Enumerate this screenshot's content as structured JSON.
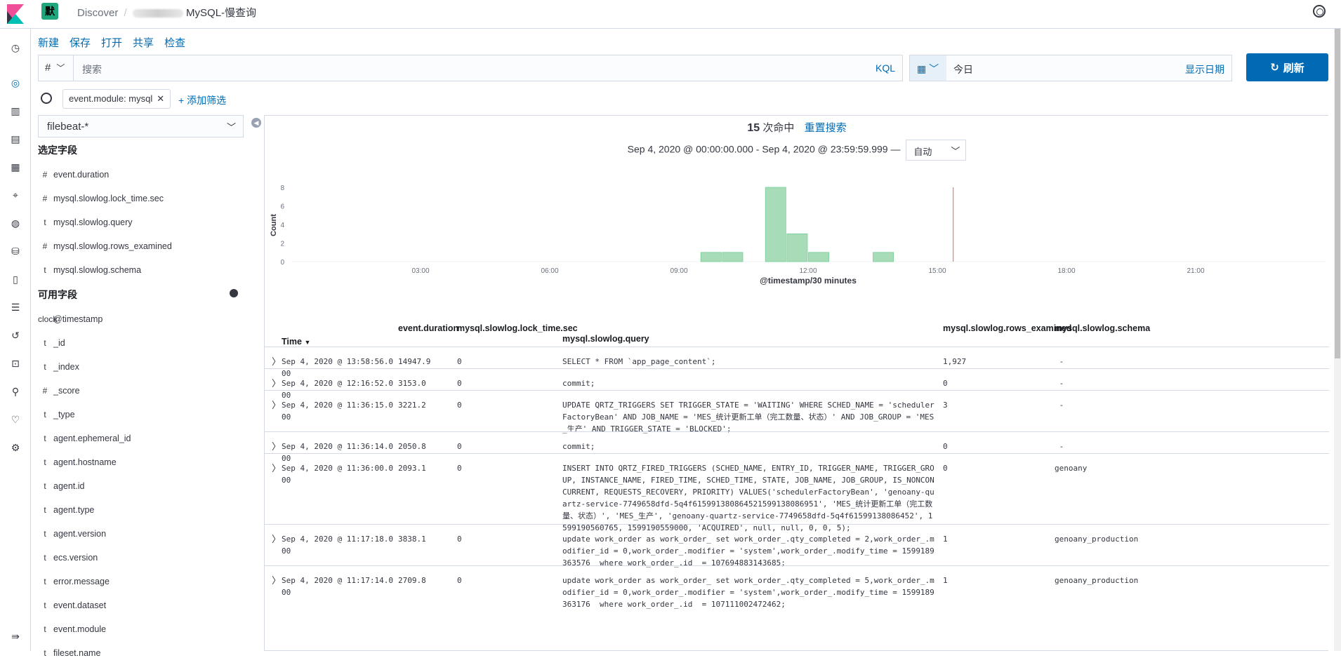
{
  "header": {
    "badge": "默",
    "crumb1": "Discover",
    "crumb_sep": "/",
    "crumb_current": "MySQL-慢查询"
  },
  "menu": [
    "新建",
    "保存",
    "打开",
    "共享",
    "检查"
  ],
  "query": {
    "type": "#",
    "placeholder": "搜索",
    "language": "KQL"
  },
  "date": {
    "value": "今日",
    "show_dates": "显示日期",
    "refresh": "刷新"
  },
  "filter": {
    "pill": "event.module: mysql",
    "add": "+ 添加筛选"
  },
  "sidebar": {
    "index_pattern": "filebeat-*",
    "selected_title": "选定字段",
    "selected": [
      {
        "type": "#",
        "name": "event.duration"
      },
      {
        "type": "#",
        "name": "mysql.slowlog.lock_time.sec"
      },
      {
        "type": "t",
        "name": "mysql.slowlog.query"
      },
      {
        "type": "#",
        "name": "mysql.slowlog.rows_examined"
      },
      {
        "type": "t",
        "name": "mysql.slowlog.schema"
      }
    ],
    "available_title": "可用字段",
    "available": [
      {
        "type": "clock",
        "name": "@timestamp"
      },
      {
        "type": "t",
        "name": "_id"
      },
      {
        "type": "t",
        "name": "_index"
      },
      {
        "type": "#",
        "name": "_score"
      },
      {
        "type": "t",
        "name": "_type"
      },
      {
        "type": "t",
        "name": "agent.ephemeral_id"
      },
      {
        "type": "t",
        "name": "agent.hostname"
      },
      {
        "type": "t",
        "name": "agent.id"
      },
      {
        "type": "t",
        "name": "agent.type"
      },
      {
        "type": "t",
        "name": "agent.version"
      },
      {
        "type": "t",
        "name": "ecs.version"
      },
      {
        "type": "t",
        "name": "error.message"
      },
      {
        "type": "t",
        "name": "event.dataset"
      },
      {
        "type": "t",
        "name": "event.module"
      },
      {
        "type": "t",
        "name": "fileset.name"
      }
    ]
  },
  "summary": {
    "count": "15",
    "hits_label": "次命中",
    "reset": "重置搜索",
    "range": "Sep 4, 2020 @ 00:00:00.000 - Sep 4, 2020 @ 23:59:59.999 —",
    "interval": "自动"
  },
  "chart_data": {
    "type": "bar",
    "ylabel": "Count",
    "xlabel": "@timestamp/30 minutes",
    "ylim": [
      0,
      8
    ],
    "yticks": [
      "0",
      "2",
      "4",
      "6",
      "8"
    ],
    "xticks": [
      "03:00",
      "06:00",
      "09:00",
      "12:00",
      "15:00",
      "18:00",
      "21:00"
    ],
    "bars": [
      {
        "start_hour": 9.5,
        "count": 1
      },
      {
        "start_hour": 10.0,
        "count": 1
      },
      {
        "start_hour": 11.0,
        "count": 8
      },
      {
        "start_hour": 11.5,
        "count": 3
      },
      {
        "start_hour": 12.0,
        "count": 1
      },
      {
        "start_hour": 13.5,
        "count": 1
      }
    ],
    "now_marker_hour": 15.37,
    "bar_color": "#a8dcb9",
    "marker_color": "#e7664c"
  },
  "table": {
    "headers": {
      "time": "Time",
      "duration": "event.duration",
      "lock": "mysql.slowlog.lock_time.sec",
      "query": "mysql.slowlog.query",
      "rows": "mysql.slowlog.rows_examined",
      "schema": "mysql.slowlog.schema"
    },
    "rows": [
      {
        "time": "Sep 4, 2020 @ 13:58:56.000",
        "duration": "14947.9",
        "lock": "0",
        "query": "SELECT * FROM `app_page_content`;",
        "rows": "1,927",
        "schema": " -"
      },
      {
        "time": "Sep 4, 2020 @ 12:16:52.000",
        "duration": "3153.0",
        "lock": "0",
        "query": "commit;",
        "rows": "0",
        "schema": " -"
      },
      {
        "time": "Sep 4, 2020 @ 11:36:15.000",
        "duration": "3221.2",
        "lock": "0",
        "query": "UPDATE QRTZ_TRIGGERS SET TRIGGER_STATE = 'WAITING' WHERE SCHED_NAME = 'schedulerFactoryBean' AND JOB_NAME = 'MES_统计更新工单（完工数量、状态）' AND JOB_GROUP = 'MES_生产' AND TRIGGER_STATE = 'BLOCKED';",
        "rows": "3",
        "schema": " -"
      },
      {
        "time": "Sep 4, 2020 @ 11:36:14.000",
        "duration": "2050.8",
        "lock": "0",
        "query": "commit;",
        "rows": "0",
        "schema": " -"
      },
      {
        "time": "Sep 4, 2020 @ 11:36:00.000",
        "duration": "2093.1",
        "lock": "0",
        "query": "INSERT INTO QRTZ_FIRED_TRIGGERS (SCHED_NAME, ENTRY_ID, TRIGGER_NAME, TRIGGER_GROUP, INSTANCE_NAME, FIRED_TIME, SCHED_TIME, STATE, JOB_NAME, JOB_GROUP, IS_NONCONCURRENT, REQUESTS_RECOVERY, PRIORITY) VALUES('schedulerFactoryBean', 'genoany-quartz-service-7749658dfd-5q4f615991380864521599138086951', 'MES_统计更新工单（完工数量、状态）', 'MES_生产', 'genoany-quartz-service-7749658dfd-5q4f61599138086452', 1599190560765, 1599190559000, 'ACQUIRED', null, null, 0, 0, 5);",
        "rows": "0",
        "schema": "genoany"
      },
      {
        "time": "Sep 4, 2020 @ 11:17:18.000",
        "duration": "3838.1",
        "lock": "0",
        "query": "update work_order as work_order_ set work_order_.qty_completed = 2,work_order_.modifier_id = 0,work_order_.modifier = 'system',work_order_.modify_time = 1599189363576  where work_order_.id  = 107694883143685;",
        "rows": "1",
        "schema": "genoany_production"
      },
      {
        "time": "Sep 4, 2020 @ 11:17:14.000",
        "duration": "2709.8",
        "lock": "0",
        "query": "update work_order as work_order_ set work_order_.qty_completed = 5,work_order_.modifier_id = 0,work_order_.modifier = 'system',work_order_.modify_time = 1599189363176  where work_order_.id  = 107111002472462;",
        "rows": "1",
        "schema": "genoany_production"
      }
    ]
  }
}
